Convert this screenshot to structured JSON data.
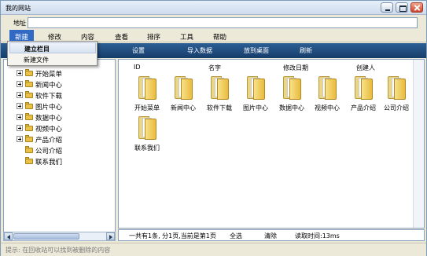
{
  "window": {
    "title": "我的网站"
  },
  "address": {
    "label": "地址",
    "value": ""
  },
  "menu": [
    {
      "label": "新建"
    },
    {
      "label": "修改"
    },
    {
      "label": "内容"
    },
    {
      "label": "查看"
    },
    {
      "label": "排序"
    },
    {
      "label": "工具"
    },
    {
      "label": "帮助"
    }
  ],
  "dropdown": [
    {
      "label": "建立栏目"
    },
    {
      "label": "新建文件"
    }
  ],
  "toolbar": [
    {
      "label": "设置"
    },
    {
      "label": "导入数据"
    },
    {
      "label": "放到桌面"
    },
    {
      "label": "刷新"
    }
  ],
  "tree": [
    {
      "label": "开始菜单",
      "expandable": true
    },
    {
      "label": "新闻中心",
      "expandable": true
    },
    {
      "label": "软件下载",
      "expandable": true
    },
    {
      "label": "图片中心",
      "expandable": true
    },
    {
      "label": "数据中心",
      "expandable": true
    },
    {
      "label": "视频中心",
      "expandable": true
    },
    {
      "label": "产品介绍",
      "expandable": true
    },
    {
      "label": "公司介绍",
      "expandable": false
    },
    {
      "label": "联系我们",
      "expandable": false
    }
  ],
  "columns": [
    {
      "label": "ID"
    },
    {
      "label": "名字"
    },
    {
      "label": "修改日期"
    },
    {
      "label": "创建人"
    }
  ],
  "folders": [
    {
      "label": "开始菜单"
    },
    {
      "label": "新闻中心"
    },
    {
      "label": "软件下载"
    },
    {
      "label": "图片中心"
    },
    {
      "label": "数据中心"
    },
    {
      "label": "视频中心"
    },
    {
      "label": "产品介绍"
    },
    {
      "label": "公司介绍"
    },
    {
      "label": "联系我们"
    }
  ],
  "content_status": {
    "summary": "一共有1条, 分1页,当前是第1页",
    "select_all": "全选",
    "clear": "清除",
    "read_time": "读取时间:13ms"
  },
  "statusbar": {
    "text": "提示: 在回收站可以找到被删除的内容"
  },
  "colors": {
    "toolbar": "#1f4d80",
    "menu_active": "#316ac5",
    "folder": "#e9bb3d"
  }
}
